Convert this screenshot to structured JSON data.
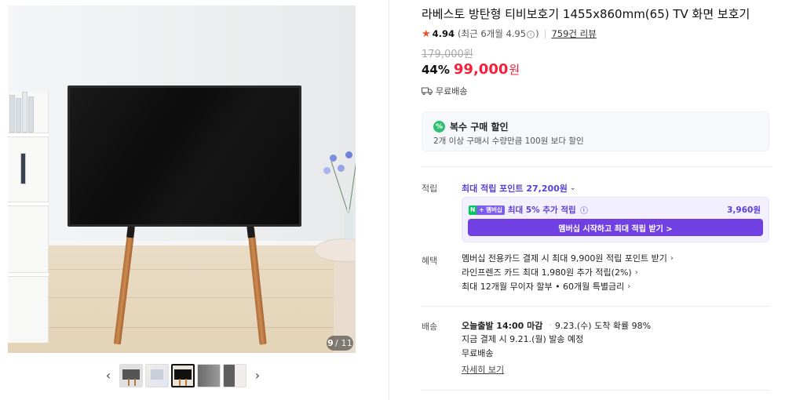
{
  "gallery": {
    "pager_current": "9",
    "pager_total": "/ 11",
    "prev_icon": "chevron-left-icon",
    "next_icon": "chevron-right-icon",
    "thumbnails": 5,
    "active_thumbnail_index": 2
  },
  "product": {
    "title": "라베스토 방탄형 티비보호기 1455x860mm(65) TV 화면 보호기",
    "rating": "4.94",
    "recent_rating": "(최근 6개월 4.95",
    "recent_rating_close": ")",
    "reviews": "759건 리뷰",
    "original_price": "179,000원",
    "discount": "44%",
    "price": "99,000",
    "currency": "원",
    "shipping": "무료배송"
  },
  "multi_discount": {
    "title": "복수 구매 할인",
    "subtitle": "2개 이상 구매시 수량만큼 100원 보다 할인",
    "icon_glyph": "%"
  },
  "points": {
    "label": "적립",
    "max_points": "최대 적립 포인트 27,200원",
    "badge_n": "N",
    "badge_membership": "+ 멤버십",
    "membership_line": "최대 5% 추가 적립",
    "membership_amount": "3,960원",
    "membership_button": "멤버십 시작하고 최대 적립 받기 >"
  },
  "benefits": {
    "label": "혜택",
    "items": [
      "멤버십 전용카드 결제 시 최대 9,900원 적립 포인트 받기",
      "라인프렌즈 카드 최대 1,980원 추가 적립(2%)",
      "최대 12개월 무이자 할부 • 60개월 특별금리"
    ]
  },
  "delivery": {
    "label": "배송",
    "deadline": "오늘출발 14:00 마감",
    "arrival": "9.23.(수) 도착 확률 98%",
    "dispatch": "지금 결제 시 9.21.(월) 발송 예정",
    "fee": "무료배송",
    "more": "자세히 보기"
  },
  "colors": {
    "price_red": "#f5213b",
    "purple": "#5b3dd8",
    "button_purple": "#7140e3",
    "star": "#f04f27"
  }
}
